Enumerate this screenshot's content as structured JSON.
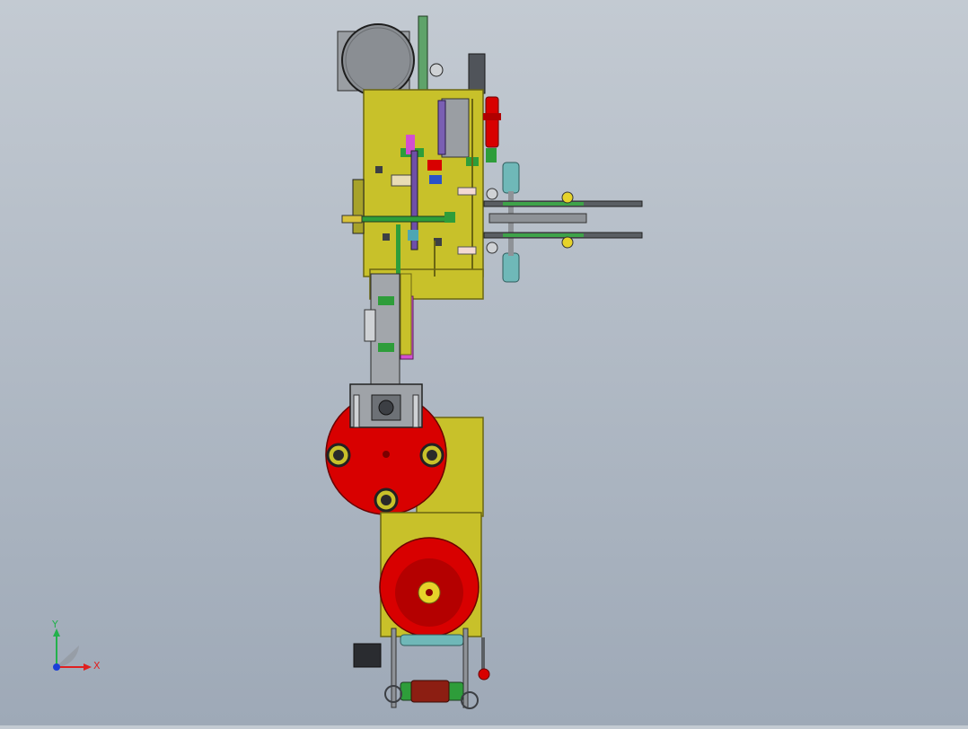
{
  "viewport": {
    "background_top": "#c3cad2",
    "background_bottom": "#9ea9b7"
  },
  "triad": {
    "y_label": "Y",
    "x_label": "X",
    "y_color": "#22b14c",
    "x_color": "#e02020",
    "z_color": "#1b3fd8"
  },
  "colors": {
    "frame": "#c8c12a",
    "frame_dark": "#8a8419",
    "disc_red": "#d80000",
    "disc_dark_red": "#8c0000",
    "steel_gray": "#8e9297",
    "dark_gray": "#3c3f44",
    "teal": "#6fb8b8",
    "green": "#2e9d3a",
    "purple": "#7a5fb3",
    "magenta": "#d24fd0",
    "blue": "#2a52c8",
    "yellow_hub": "#e6d32a"
  }
}
